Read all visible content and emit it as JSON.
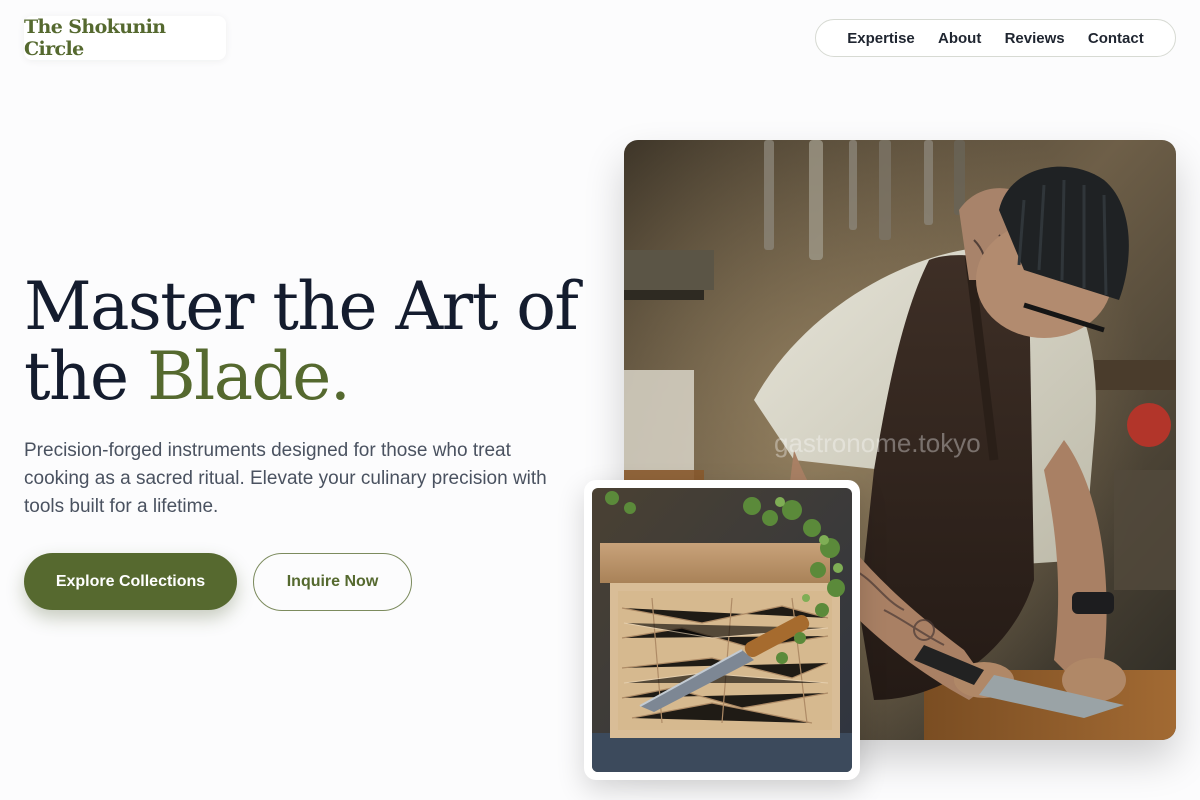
{
  "brand": {
    "name": "The Shokunin Circle"
  },
  "nav": {
    "items": [
      "Expertise",
      "About",
      "Reviews",
      "Contact"
    ]
  },
  "hero": {
    "headline_part1": "Master the Art of",
    "headline_part2": "the",
    "headline_accent": "Blade.",
    "subtitle": "Precision-forged instruments designed for those who treat cooking as a sacred ritual. Elevate your culinary precision with tools built for a lifetime.",
    "primary_button": "Explore Collections",
    "secondary_button": "Inquire Now"
  },
  "images": {
    "main": {
      "watermark": "gastronome.tokyo"
    },
    "inset": {}
  },
  "colors": {
    "accent": "#55692f",
    "heading": "#141c2e",
    "body_text": "#4a5260",
    "background": "#fcfcfd"
  }
}
